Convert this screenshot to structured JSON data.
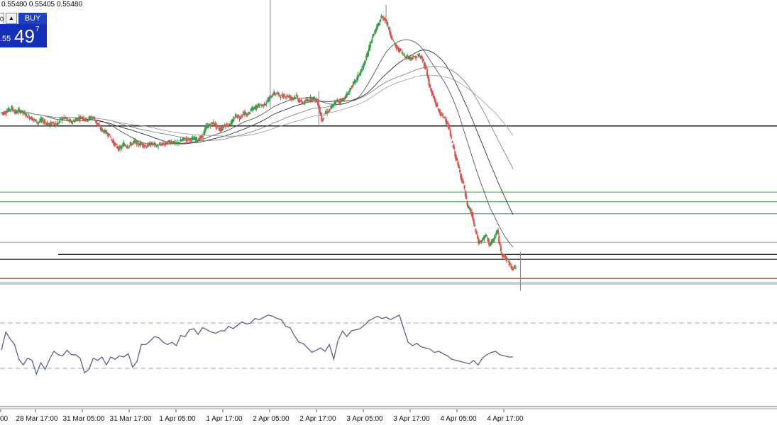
{
  "ohlc_text": "0.55480 0.55405 0.55480",
  "trade_panel": {
    "lot_value": "0",
    "arrow": "▲",
    "buy_label": "BUY",
    "price_prefix": ".55",
    "price_big": "49",
    "price_sup": "7"
  },
  "chart_data": {
    "type": "candlestick",
    "title": "",
    "x_tick_labels": [
      "00",
      "28 Mar 17:00",
      "31 Mar 05:00",
      "31 Mar 17:00",
      "1 Apr 05:00",
      "1 Apr 17:00",
      "2 Apr 05:00",
      "2 Apr 17:00",
      "3 Apr 05:00",
      "3 Apr 17:00",
      "4 Apr 05:00",
      "4 Apr 17:00"
    ],
    "price_series_close": [
      0.5546,
      0.5547,
      0.5548,
      0.5546,
      0.5547,
      0.5546,
      0.5545,
      0.5544,
      0.5543,
      0.5542,
      0.5543,
      0.5542,
      0.5541,
      0.5542,
      0.5541,
      0.5543,
      0.5544,
      0.5543,
      0.5542,
      0.5543,
      0.5544,
      0.5544,
      0.5543,
      0.5544,
      0.5544,
      0.5541,
      0.5539,
      0.5538,
      0.5537,
      0.5534,
      0.5532,
      0.5531,
      0.5533,
      0.5532,
      0.5533,
      0.5534,
      0.5533,
      0.5533,
      0.5532,
      0.5533,
      0.5533,
      0.5532,
      0.5533,
      0.5533,
      0.5534,
      0.5534,
      0.5533,
      0.5534,
      0.5535,
      0.5535,
      0.5535,
      0.5535,
      0.5535,
      0.5536,
      0.554,
      0.5541,
      0.5542,
      0.554,
      0.5539,
      0.5541,
      0.5541,
      0.5542,
      0.5545,
      0.5544,
      0.5546,
      0.5545,
      0.5547,
      0.5548,
      0.5549,
      0.5549,
      0.555,
      0.5552,
      0.5554,
      0.5554,
      0.5553,
      0.5553,
      0.5553,
      0.5552,
      0.5553,
      0.5551,
      0.555,
      0.5551,
      0.5552,
      0.5552,
      0.555,
      0.5543,
      0.5546,
      0.5547,
      0.5549,
      0.5551,
      0.5551,
      0.5552,
      0.5554,
      0.5557,
      0.5559,
      0.5562,
      0.5565,
      0.5569,
      0.5575,
      0.5579,
      0.5582,
      0.5586,
      0.5585,
      0.5581,
      0.5576,
      0.5573,
      0.5572,
      0.557,
      0.5569,
      0.5569,
      0.5569,
      0.557,
      0.5568,
      0.5564,
      0.5556,
      0.5552,
      0.5548,
      0.5545,
      0.5544,
      0.554,
      0.5533,
      0.5527,
      0.5521,
      0.5516,
      0.5507,
      0.5505,
      0.5498,
      0.5492,
      0.5493,
      0.5495,
      0.5491,
      0.5493,
      0.5497,
      0.5488,
      0.5486,
      0.5484,
      0.5481,
      0.5482
    ],
    "overlays": [
      "moving-average-1",
      "moving-average-2",
      "moving-average-3",
      "moving-average-4"
    ],
    "horizontal_levels": {
      "black": [
        0.55405,
        0.55405,
        0.5487,
        0.5485
      ],
      "green": [
        0.5513,
        0.5509,
        0.5504
      ],
      "gray": [
        0.5492
      ],
      "red": [
        0.5477
      ]
    },
    "oscillator": {
      "series": [
        46,
        62,
        56,
        51,
        38,
        33,
        39,
        37,
        25,
        35,
        29,
        38,
        45,
        42,
        41,
        46,
        42,
        42,
        39,
        26,
        29,
        39,
        37,
        40,
        33,
        40,
        38,
        41,
        40,
        43,
        31,
        36,
        51,
        51,
        54,
        58,
        57,
        53,
        51,
        53,
        50,
        59,
        58,
        64,
        65,
        60,
        66,
        64,
        62,
        61,
        63,
        63,
        67,
        65,
        68,
        71,
        69,
        70,
        74,
        73,
        75,
        77,
        76,
        74,
        73,
        67,
        66,
        59,
        53,
        52,
        48,
        44,
        46,
        48,
        45,
        51,
        38,
        55,
        63,
        58,
        63,
        64,
        65,
        68,
        72,
        74,
        76,
        74,
        75,
        73,
        75,
        77,
        65,
        53,
        50,
        52,
        49,
        48,
        47,
        44,
        45,
        43,
        41,
        38,
        37,
        36,
        35,
        34,
        37,
        33,
        39,
        42,
        44,
        45,
        42,
        41,
        40,
        40
      ],
      "levels": [
        70,
        30
      ]
    }
  }
}
